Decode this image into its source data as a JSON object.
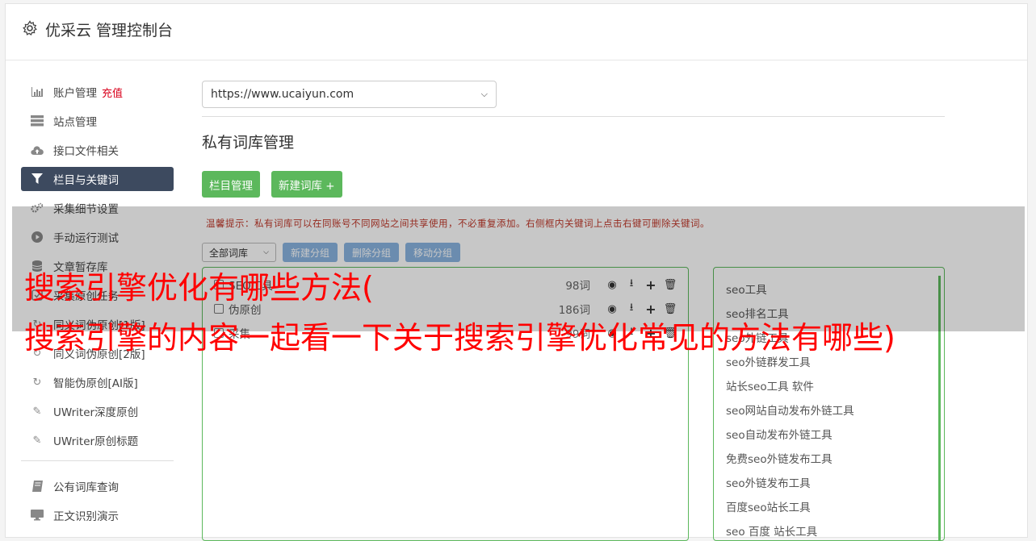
{
  "header": {
    "title": "优采云 管理控制台",
    "icon": "gear-icon"
  },
  "sidebar": {
    "items": [
      {
        "label": "账户管理",
        "badge": "充值",
        "icon": "bar-chart-icon"
      },
      {
        "label": "站点管理",
        "icon": "server-icon"
      },
      {
        "label": "接口文件相关",
        "icon": "cloud-upload-icon"
      },
      {
        "label": "栏目与关键词",
        "icon": "filter-icon",
        "active": true
      },
      {
        "label": "采集细节设置",
        "icon": "cogs-icon"
      },
      {
        "label": "手动运行测试",
        "icon": "play-icon"
      },
      {
        "label": "文章暂存库",
        "icon": "database-icon"
      },
      {
        "label": "采集原创任务",
        "icon": "task-icon"
      },
      {
        "label": "同义词伪原创[1版]",
        "icon": "refresh-icon"
      },
      {
        "label": "同义词伪原创[2版]",
        "icon": "refresh-icon"
      },
      {
        "label": "智能伪原创[AI版]",
        "icon": "refresh-icon"
      },
      {
        "label": "UWriter深度原创",
        "icon": "edit-icon"
      },
      {
        "label": "UWriter原创标题",
        "icon": "edit-icon"
      }
    ],
    "items2": [
      {
        "label": "公有词库查询",
        "icon": "book-icon"
      },
      {
        "label": "正文识别演示",
        "icon": "monitor-icon"
      }
    ]
  },
  "main": {
    "site_select": "https://www.ucaiyun.com",
    "page_title": "私有词库管理",
    "btn_columns": "栏目管理",
    "btn_new_lib": "新建词库 +",
    "tip": "温馨提示：私有词库可以在同账号不同网站之间共享使用，不必重复添加。右侧框内关键词上点击右键可删除关键词。",
    "lib_select": "全部词库",
    "btn_new_group": "新建分组",
    "btn_delete_group": "删除分组",
    "btn_move_group": "移动分组",
    "groups": [
      {
        "name": "SEO工具",
        "count": "98词"
      },
      {
        "name": "伪原创",
        "count": "186词"
      },
      {
        "name": "采集",
        "count": "99词"
      }
    ],
    "keywords": [
      "seo工具",
      "seo排名工具",
      "seo外链工具",
      "seo外链群发工具",
      "站长seo工具 软件",
      "seo网站自动发布外链工具",
      "seo自动发布外链工具",
      "免费seo外链发布工具",
      "seo外链发布工具",
      "百度seo站长工具",
      "seo 百度 站长工具"
    ]
  },
  "overlay": {
    "line1": "搜索引擎优化有哪些方法(",
    "line2": "搜索引擎的内容一起看一下关于搜索引擎优化常见的方法有哪些)"
  }
}
